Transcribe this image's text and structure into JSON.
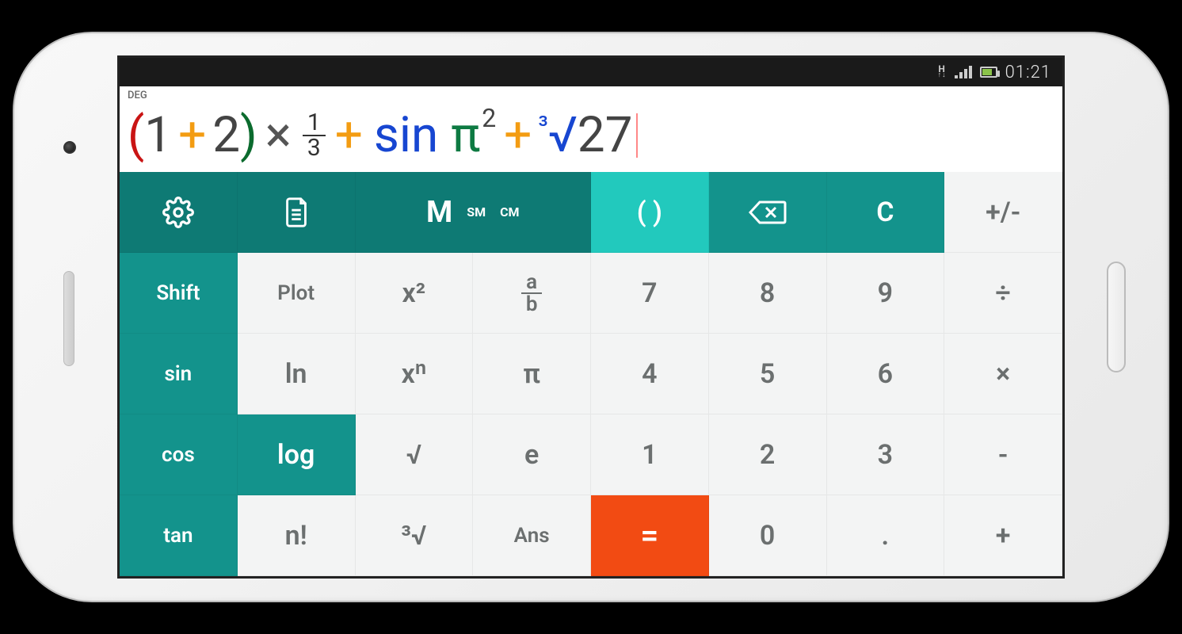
{
  "status": {
    "network": "H",
    "time": "01:21"
  },
  "display": {
    "mode": "DEG",
    "expr": {
      "paren_open": "(",
      "one": "1",
      "plus1": "+",
      "two": "2",
      "paren_close": ")",
      "times": "×",
      "frac_num": "1",
      "frac_den": "3",
      "plus2": "+",
      "sin": "sin",
      "pi": "π",
      "sup2": "2",
      "plus3": "+",
      "cube": "³",
      "root": "√",
      "n27": "27"
    }
  },
  "keys": {
    "settings": "⚙",
    "history": "≡",
    "memory_m": "M",
    "memory_sm": "SM",
    "memory_cm": "CM",
    "parens": "(   )",
    "backspace": "⌫",
    "clear": "C",
    "signtoggle": "+/-",
    "shift": "Shift",
    "plot": "Plot",
    "xsq": "x²",
    "frac_a": "a",
    "frac_b": "b",
    "k7": "7",
    "k8": "8",
    "k9": "9",
    "div": "÷",
    "sin": "sin",
    "ln": "ln",
    "xn": "xⁿ",
    "pi": "π",
    "k4": "4",
    "k5": "5",
    "k6": "6",
    "mul": "×",
    "cos": "cos",
    "log": "log",
    "sqrt": "√",
    "e": "e",
    "k1": "1",
    "k2": "2",
    "k3": "3",
    "sub": "-",
    "tan": "tan",
    "fact": "n!",
    "cbrt": "³√",
    "ans": "Ans",
    "eq": "=",
    "k0": "0",
    "dot": ".",
    "add": "+"
  }
}
